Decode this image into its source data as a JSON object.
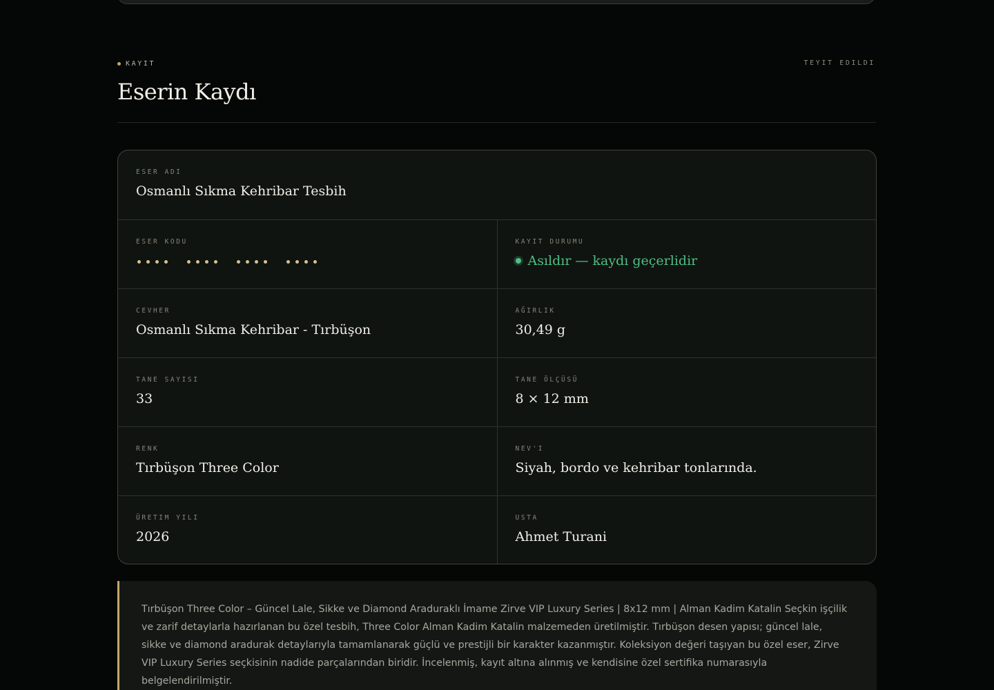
{
  "header": {
    "eyebrow": "Kayıt",
    "status_right": "Teyit Edildi",
    "title": "Eserin Kaydı"
  },
  "record": {
    "name_label": "Eser Adı",
    "name_value": "Osmanlı Sıkma Kehribar Tesbih",
    "code_label": "Eser Kodu",
    "code_masked": true,
    "status_label": "Kayıt Durumu",
    "status_value": "Asıldır — kaydı geçerlidir",
    "material_label": "Cevher",
    "material_value": "Osmanlı Sıkma Kehribar - Tırbüşon",
    "weight_label": "Ağırlık",
    "weight_value": "30,49 g",
    "count_label": "Tane Sayısı",
    "count_value": "33",
    "size_label": "Tane Ölçüsü",
    "size_value": "8 × 12 mm",
    "color_label": "Renk",
    "color_value": "Tırbüşon Three Color",
    "type_label": "Nev'i",
    "type_value": "Siyah, bordo ve kehribar tonlarında.",
    "year_label": "Üretim Yılı",
    "year_value": "2026",
    "master_label": "Usta",
    "master_value": "Ahmet Turani"
  },
  "description": "Tırbüşon Three Color – Güncel Lale, Sikke ve Diamond Aradurak­lı İmame Zirve VIP Luxury Series | 8x12 mm | Alman Kadim Katalin Seçkin işçilik ve zarif detaylarla hazırlanan bu özel tesbih, Three Color Alman Kadim Katalin malzemeden üretilmiştir. Tırbüşon desen yapısı; güncel lale, sikke ve diamond aradurak detaylarıyla tamamlanarak güçlü ve prestijli bir karakter kazanmıştır. Koleksiyon değeri taşıyan bu özel eser, Zirve VIP Luxury Series seçkisinin nadide parçalarından biridir. İncelenmiş, kayıt altına alınmış ve kendisine özel sertifika numarasıyla belgelendirilmiştir.",
  "colors": {
    "background": "#050706",
    "card": "#101410",
    "accent_gold": "#c6a86a",
    "status_green": "#4fbf86"
  },
  "icons": {
    "eyebrow": "dot-icon",
    "status": "status-dot-icon",
    "code": "masked-dots-icon"
  }
}
